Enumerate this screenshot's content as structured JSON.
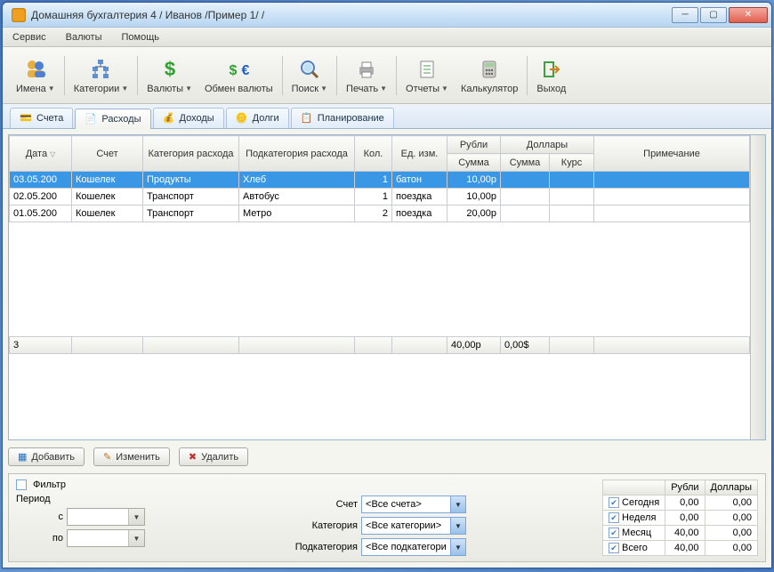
{
  "window": {
    "title": "Домашняя бухгалтерия 4  / Иванов /Пример 1/ /"
  },
  "menu": {
    "service": "Сервис",
    "currencies": "Валюты",
    "help": "Помощь"
  },
  "toolbar": {
    "names": "Имена",
    "categories": "Категории",
    "currencies": "Валюты",
    "exchange": "Обмен валюты",
    "search": "Поиск",
    "print": "Печать",
    "reports": "Отчеты",
    "calculator": "Калькулятор",
    "exit": "Выход"
  },
  "tabs": {
    "accounts": "Счета",
    "expenses": "Расходы",
    "income": "Доходы",
    "debts": "Долги",
    "planning": "Планирование"
  },
  "grid": {
    "headers": {
      "date": "Дата",
      "account": "Счет",
      "category": "Категория расхода",
      "subcategory": "Подкатегория расхода",
      "qty": "Кол.",
      "unit": "Ед. изм.",
      "rubles": "Рубли",
      "dollars": "Доллары",
      "sum": "Сумма",
      "rate": "Курс",
      "note": "Примечание"
    },
    "rows": [
      {
        "date": "03.05.200",
        "account": "Кошелек",
        "category": "Продукты",
        "subcategory": "Хлеб",
        "qty": "1",
        "unit": "батон",
        "rub_sum": "10,00р",
        "usd_sum": "",
        "rate": "",
        "note": ""
      },
      {
        "date": "02.05.200",
        "account": "Кошелек",
        "category": "Транспорт",
        "subcategory": "Автобус",
        "qty": "1",
        "unit": "поездка",
        "rub_sum": "10,00р",
        "usd_sum": "",
        "rate": "",
        "note": ""
      },
      {
        "date": "01.05.200",
        "account": "Кошелек",
        "category": "Транспорт",
        "subcategory": "Метро",
        "qty": "2",
        "unit": "поездка",
        "rub_sum": "20,00р",
        "usd_sum": "",
        "rate": "",
        "note": ""
      }
    ],
    "footer": {
      "count": "3",
      "rub_total": "40,00р",
      "usd_total": "0,00$"
    }
  },
  "buttons": {
    "add": "Добавить",
    "edit": "Изменить",
    "delete": "Удалить"
  },
  "filter": {
    "title": "Фильтр",
    "period": "Период",
    "from": "с",
    "to": "по",
    "account_lbl": "Счет",
    "category_lbl": "Категория",
    "subcategory_lbl": "Подкатегория",
    "all_accounts": "<Все счета>",
    "all_categories": "<Все категории>",
    "all_subcategories": "<Все подкатегори"
  },
  "summary": {
    "rub": "Рубли",
    "usd": "Доллары",
    "today": "Сегодня",
    "week": "Неделя",
    "month": "Месяц",
    "total": "Всего",
    "vals": {
      "today_rub": "0,00",
      "today_usd": "0,00",
      "week_rub": "0,00",
      "week_usd": "0,00",
      "month_rub": "40,00",
      "month_usd": "0,00",
      "total_rub": "40,00",
      "total_usd": "0,00"
    }
  }
}
